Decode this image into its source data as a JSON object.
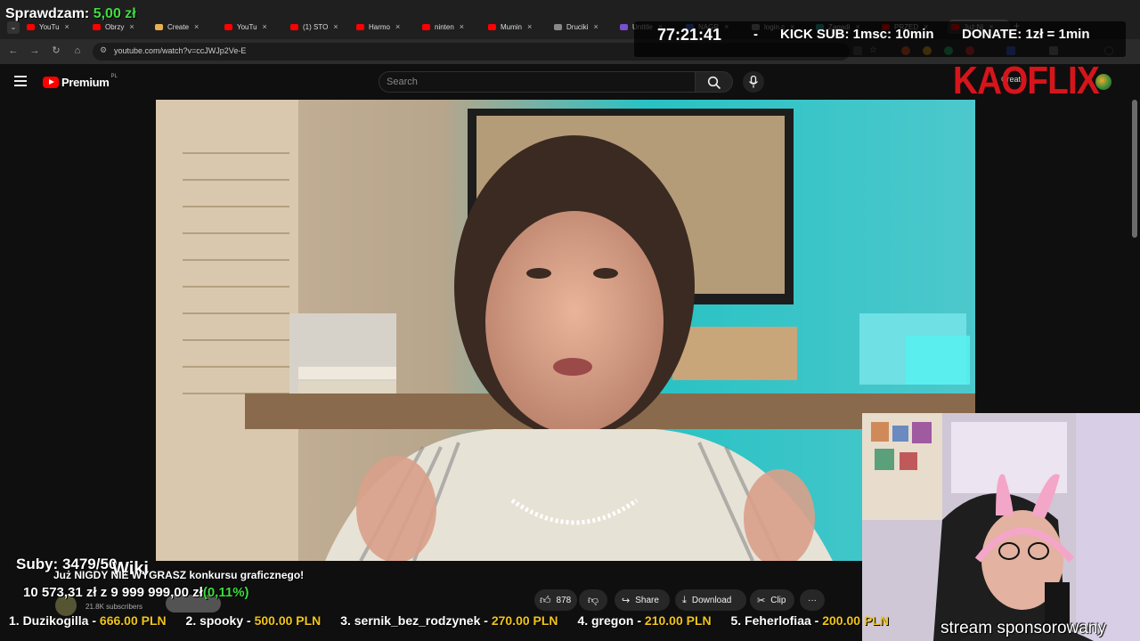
{
  "browser": {
    "tabs": [
      {
        "label": "YouTu",
        "color": "#ff0000"
      },
      {
        "label": "Obrzy",
        "color": "#ff0000"
      },
      {
        "label": "Create",
        "color": "#e8b050"
      },
      {
        "label": "YouTu",
        "color": "#ff0000"
      },
      {
        "label": "(1) STO",
        "color": "#ff0000"
      },
      {
        "label": "Harmo",
        "color": "#ff0000"
      },
      {
        "label": "ninten",
        "color": "#ff0000"
      },
      {
        "label": "Mumin",
        "color": "#ff0000"
      },
      {
        "label": "Druciki",
        "color": "#888888"
      },
      {
        "label": "Untitle",
        "color": "#7a4fd0"
      },
      {
        "label": "NAGR",
        "color": "#3a6ad0"
      },
      {
        "label": "login.c",
        "color": "#888888"
      },
      {
        "label": "Zagadi",
        "color": "#2aa0a0"
      },
      {
        "label": "PRZED",
        "color": "#ff0000"
      },
      {
        "label": "Już Ni",
        "color": "#ff0000"
      }
    ],
    "url": "youtube.com/watch?v=ccJWJp2Ve-E"
  },
  "overlay": {
    "checking_label": "Sprawdzam:",
    "checking_amount": "5,00 zł",
    "timer": "77:21:41",
    "separator": "-",
    "kick_sub": "KICK SUB: 1msc: 10min",
    "donate": "DONATE: 1zł = 1min",
    "brand": "KAOFLIX",
    "subs": "Suby: 3479/50",
    "wiki": "Wiki",
    "stream_title": "Już NIGDY NIE WYGRASZ konkursu graficznego!",
    "goal": "10 573,31 zł z 9 999 999,00 zł",
    "goal_pct": "(0,11%)",
    "sponsor": "stream sponsorowany",
    "leaderboard": [
      {
        "rank": "1. Duzikogilla",
        "amount": "666.00 PLN"
      },
      {
        "rank": "2. spooky",
        "amount": "500.00 PLN"
      },
      {
        "rank": "3. sernik_bez_rodzynek",
        "amount": "270.00 PLN"
      },
      {
        "rank": "4. gregon",
        "amount": "210.00 PLN"
      },
      {
        "rank": "5. Feherlofiaa",
        "amount": "200.00 PLN"
      }
    ]
  },
  "youtube": {
    "brand": "Premium",
    "country": "PL",
    "search_placeholder": "Search",
    "create_label": "Create",
    "subscribers": "21.8K subscribers",
    "actions": {
      "likes": "878",
      "share": "Share",
      "download": "Download",
      "clip": "Clip",
      "more": "···"
    }
  }
}
